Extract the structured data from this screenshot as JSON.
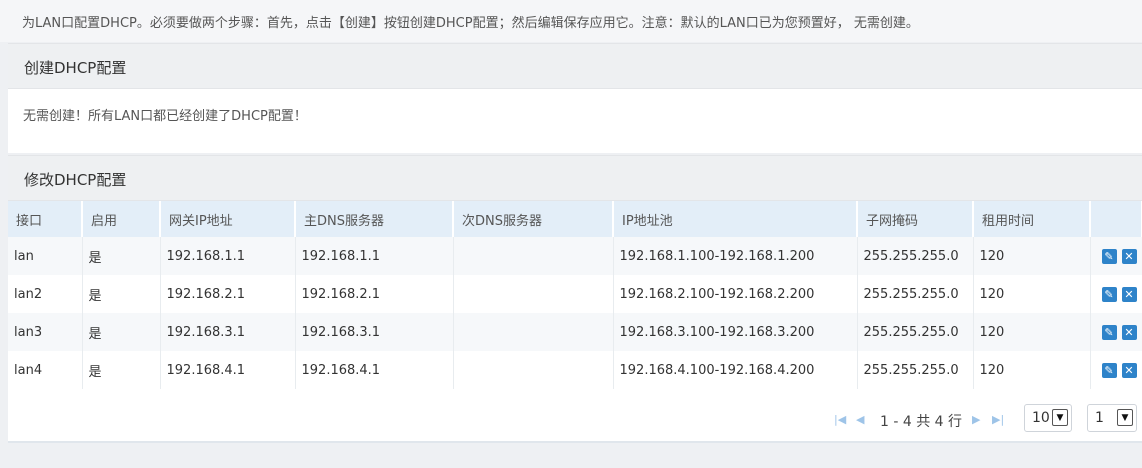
{
  "top_note": "为LAN口配置DHCP。必须要做两个步骤：首先，点击【创建】按钮创建DHCP配置；然后编辑保存应用它。注意：默认的LAN口已为您预置好， 无需创建。",
  "create_section": {
    "title": "创建DHCP配置",
    "message": "无需创建！所有LAN口都已经创建了DHCP配置！"
  },
  "edit_section": {
    "title": "修改DHCP配置"
  },
  "table": {
    "columns": [
      "接口",
      "启用",
      "网关IP地址",
      "主DNS服务器",
      "次DNS服务器",
      "IP地址池",
      "子网掩码",
      "租用时间",
      ""
    ],
    "rows": [
      {
        "iface": "lan",
        "enabled": "是",
        "gateway": "192.168.1.1",
        "dns1": "192.168.1.1",
        "dns2": "",
        "pool": "192.168.1.100-192.168.1.200",
        "mask": "255.255.255.0",
        "lease": "120"
      },
      {
        "iface": "lan2",
        "enabled": "是",
        "gateway": "192.168.2.1",
        "dns1": "192.168.2.1",
        "dns2": "",
        "pool": "192.168.2.100-192.168.2.200",
        "mask": "255.255.255.0",
        "lease": "120"
      },
      {
        "iface": "lan3",
        "enabled": "是",
        "gateway": "192.168.3.1",
        "dns1": "192.168.3.1",
        "dns2": "",
        "pool": "192.168.3.100-192.168.3.200",
        "mask": "255.255.255.0",
        "lease": "120"
      },
      {
        "iface": "lan4",
        "enabled": "是",
        "gateway": "192.168.4.1",
        "dns1": "192.168.4.1",
        "dns2": "",
        "pool": "192.168.4.100-192.168.4.200",
        "mask": "255.255.255.0",
        "lease": "120"
      }
    ],
    "action_icons": [
      "pencil-icon",
      "close-icon"
    ]
  },
  "pager": {
    "range_text": "1 - 4 共 4 行",
    "page_size": "10",
    "page": "1"
  },
  "colors": {
    "header_bg": "#e3eef8",
    "action_blue": "#2e83c9",
    "pager_arrow": "#9ec4e8"
  }
}
